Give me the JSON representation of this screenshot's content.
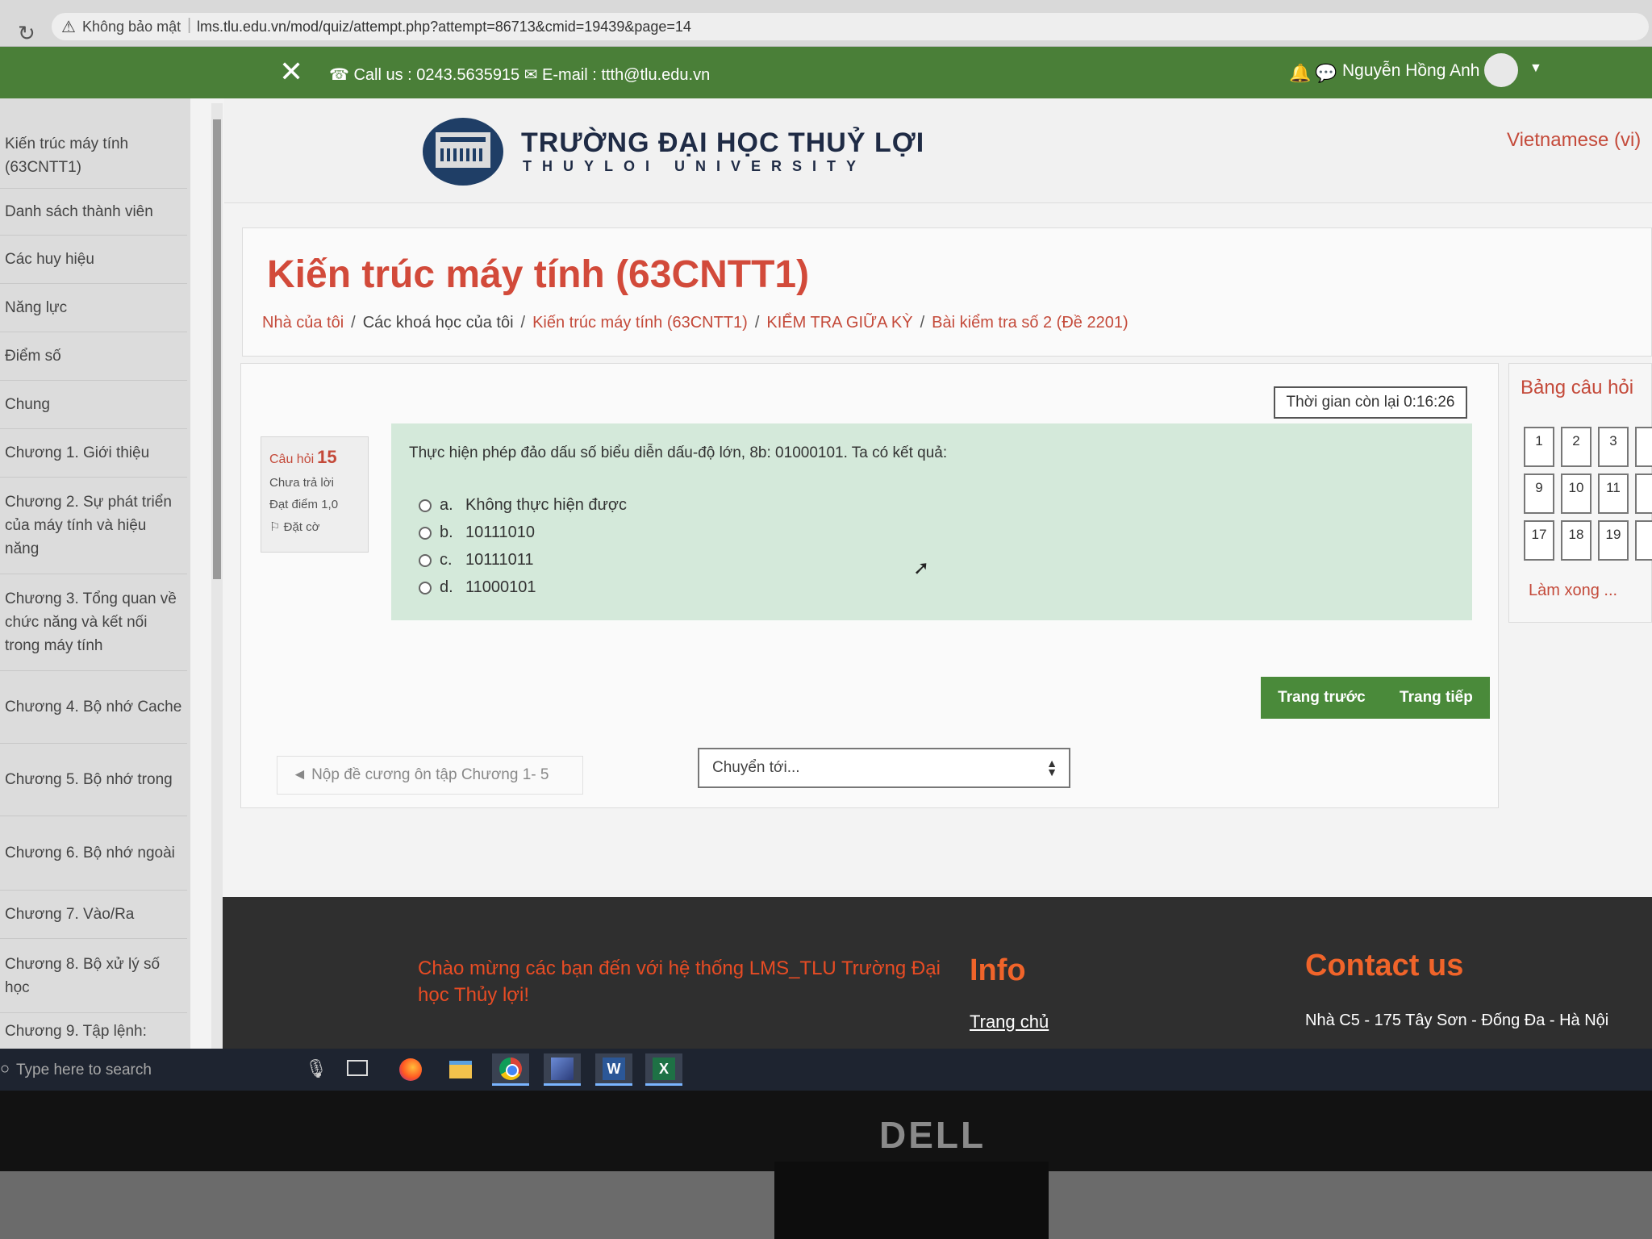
{
  "browser": {
    "security_label": "Không bảo mật",
    "url": "lms.tlu.edu.vn/mod/quiz/attempt.php?attempt=86713&cmid=19439&page=14"
  },
  "topnav": {
    "contact_text": "☎ Call us : 0243.5635915 ✉ E-mail : ttth@tlu.edu.vn",
    "user_name": "Nguyễn Hồng Anh"
  },
  "sidebar": {
    "items": [
      {
        "label": "Kiến trúc máy tính (63CNTT1)"
      },
      {
        "label": "Danh sách thành viên"
      },
      {
        "label": "Các huy hiệu"
      },
      {
        "label": "Năng lực"
      },
      {
        "label": "Điểm số"
      },
      {
        "label": "Chung"
      },
      {
        "label": "Chương 1. Giới thiệu"
      },
      {
        "label": "Chương 2. Sự phát triển của máy tính và hiệu năng"
      },
      {
        "label": "Chương 3. Tổng quan về chức năng và kết nối trong máy tính"
      },
      {
        "label": "Chương 4. Bộ nhớ Cache"
      },
      {
        "label": "Chương 5. Bộ nhớ trong"
      },
      {
        "label": "Chương 6. Bộ nhớ ngoài"
      },
      {
        "label": "Chương 7. Vào/Ra"
      },
      {
        "label": "Chương 8. Bộ xử lý số học"
      },
      {
        "label": "Chương 9. Tập lệnh:"
      }
    ]
  },
  "header": {
    "university_vn": "TRƯỜNG ĐẠI HỌC THUỶ LỢI",
    "university_en": "THUYLOI UNIVERSITY",
    "language": "Vietnamese (vi)"
  },
  "course": {
    "title": "Kiến trúc máy tính (63CNTT1)",
    "breadcrumb": [
      "Nhà của tôi",
      "Các khoá học của tôi",
      "Kiến trúc máy tính (63CNTT1)",
      "KIỂM TRA GIỮA KỲ",
      "Bài kiểm tra số 2 (Đề 2201)"
    ]
  },
  "quiz": {
    "timer": "Thời gian còn lại 0:16:26",
    "question_label": "Câu hỏi",
    "question_number": "15",
    "status": "Chưa trả lời",
    "mark": "Đạt điểm 1,0",
    "flag": "Đặt cờ",
    "question_text": "Thực hiện phép đảo dấu số biểu diễn dấu-độ lớn, 8b: 01000101. Ta có kết quả:",
    "answers": [
      {
        "letter": "a.",
        "text": "Không thực hiện được"
      },
      {
        "letter": "b.",
        "text": "10111010"
      },
      {
        "letter": "c.",
        "text": "10111011"
      },
      {
        "letter": "d.",
        "text": "11000101"
      }
    ],
    "prev_page_button": "Trang trước",
    "next_page_button": "Trang tiếp",
    "prev_activity": "◄ Nộp đề cương ôn tập Chương 1- 5",
    "jump_placeholder": "Chuyển tới..."
  },
  "question_nav": {
    "title": "Bảng câu hỏi",
    "numbers": [
      "1",
      "2",
      "3",
      "9",
      "10",
      "11",
      "17",
      "18",
      "19"
    ],
    "finish_link": "Làm xong ..."
  },
  "footer": {
    "welcome": "Chào mừng các bạn đến với hệ thống LMS_TLU Trường Đại học Thủy lợi!",
    "info_heading": "Info",
    "home_link": "Trang chủ",
    "contact_heading": "Contact us",
    "address": "Nhà C5 - 175 Tây Sơn - Đống Đa - Hà Nội"
  },
  "taskbar": {
    "search_placeholder": "Type here to search"
  },
  "monitor": {
    "brand": "DELL"
  }
}
